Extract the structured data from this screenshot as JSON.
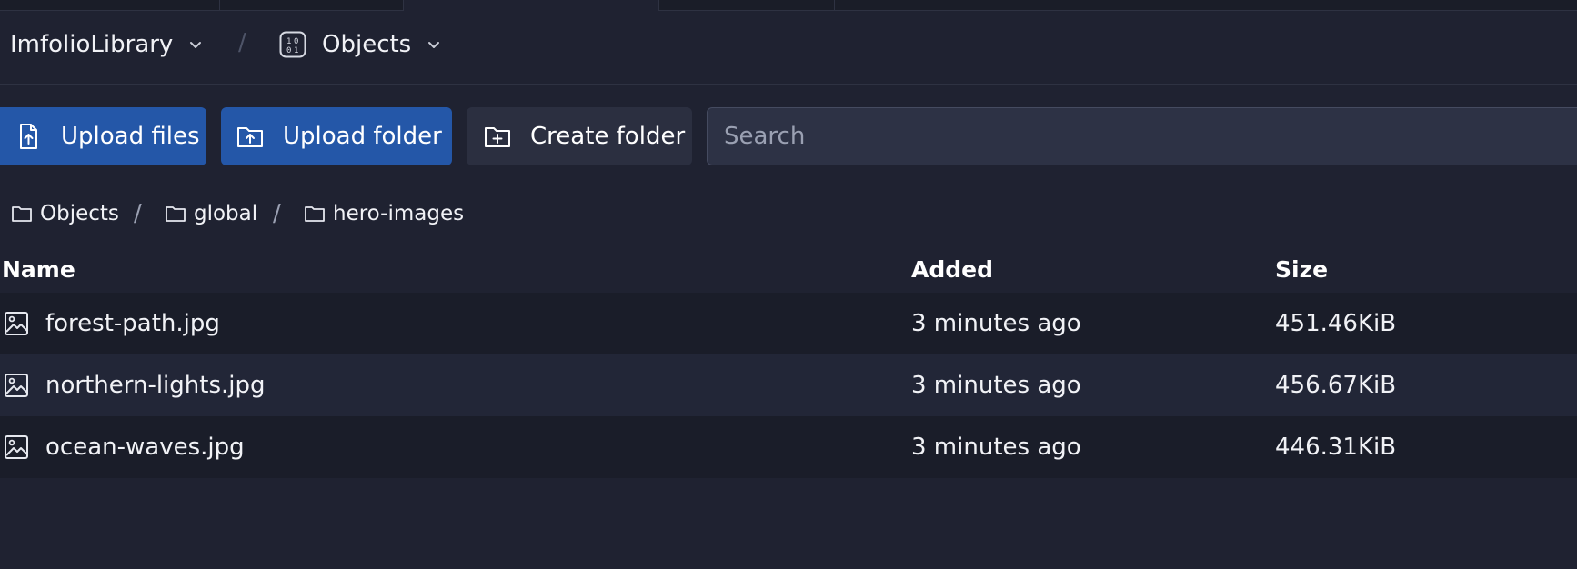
{
  "header": {
    "library_name": "ImfolioLibrary",
    "separator": "/",
    "section_name": "Objects"
  },
  "toolbar": {
    "upload_files_label": "Upload files",
    "upload_folder_label": "Upload folder",
    "create_folder_label": "Create folder",
    "search_placeholder": "Search"
  },
  "path": {
    "items": [
      {
        "label": "Objects"
      },
      {
        "label": "global"
      },
      {
        "label": "hero-images"
      }
    ],
    "separator": "/"
  },
  "table": {
    "columns": [
      "Name",
      "Added",
      "Size"
    ],
    "rows": [
      {
        "name": "forest-path.jpg",
        "added": "3 minutes ago",
        "size": "451.46KiB"
      },
      {
        "name": "northern-lights.jpg",
        "added": "3 minutes ago",
        "size": "456.67KiB"
      },
      {
        "name": "ocean-waves.jpg",
        "added": "3 minutes ago",
        "size": "446.31KiB"
      }
    ]
  },
  "colors": {
    "background": "#1f2231",
    "primary_button": "#2457a8",
    "secondary_button": "#2b2f40",
    "row_odd": "#1a1d29",
    "row_even": "#222637"
  },
  "icons": {
    "library_chevron": "chevron-down-icon",
    "objects_icon": "binary-icon",
    "upload_files": "file-upload-icon",
    "upload_folder": "folder-upload-icon",
    "create_folder": "folder-plus-icon",
    "path_folder": "folder-icon",
    "row_image": "image-icon"
  }
}
